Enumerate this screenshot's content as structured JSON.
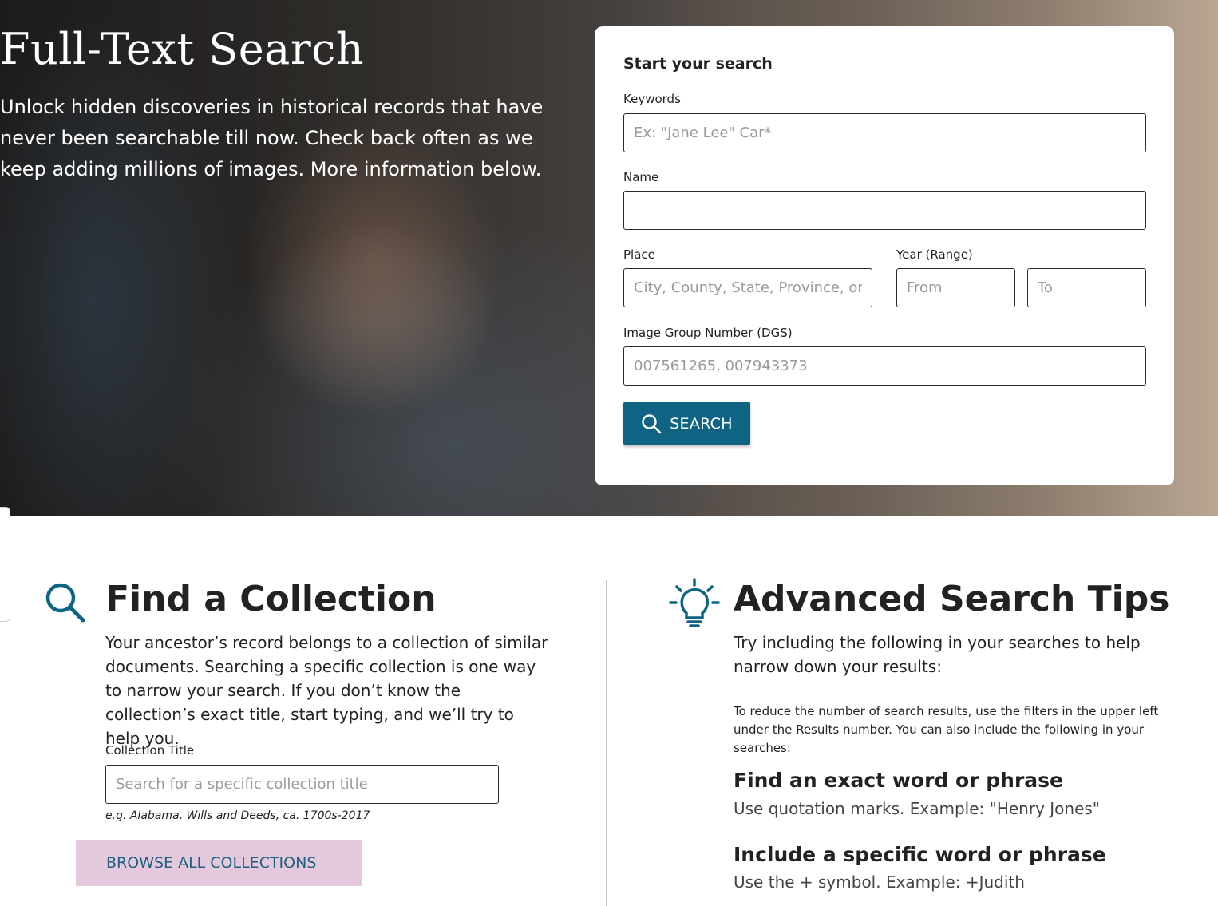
{
  "hero": {
    "title": "Full-Text Search",
    "description": "Unlock hidden discoveries in historical records that have never been searchable till now. Check back often as we keep adding millions of images. More information below."
  },
  "search_form": {
    "title": "Start your search",
    "keywords_label": "Keywords",
    "keywords_placeholder": "Ex: \"Jane Lee\" Car*",
    "name_label": "Name",
    "place_label": "Place",
    "place_placeholder": "City, County, State, Province, or",
    "year_label": "Year (Range)",
    "year_from_placeholder": "From",
    "year_to_placeholder": "To",
    "dgs_label": "Image Group Number (DGS)",
    "dgs_placeholder": "007561265, 007943373",
    "search_button": "SEARCH",
    "accent_color": "#0f6483"
  },
  "find_collection": {
    "icon": "search-icon",
    "title": "Find a Collection",
    "description": "Your ancestor’s record belongs to a collection of similar documents. Searching a specific collection is one way to narrow your search. If you don’t know the collection’s exact title, start typing, and we’ll try to help you.",
    "collection_label": "Collection Title",
    "collection_placeholder": "Search for a specific collection title",
    "example": "e.g. Alabama, Wills and Deeds, ca. 1700s-2017",
    "browse_button": "BROWSE ALL COLLECTIONS"
  },
  "tips": {
    "icon": "lightbulb-icon",
    "title": "Advanced Search Tips",
    "intro": "Try including the following in your searches to help narrow down your results:",
    "detail": "To reduce the number of search results, use the filters in the upper left under the Results number. You can also include the following in your searches:",
    "items": [
      {
        "title": "Find an exact word or phrase",
        "text": "Use quotation marks. Example: \"Henry Jones\""
      },
      {
        "title": "Include a specific word or phrase",
        "text": "Use the + symbol. Example: +Judith"
      }
    ]
  }
}
